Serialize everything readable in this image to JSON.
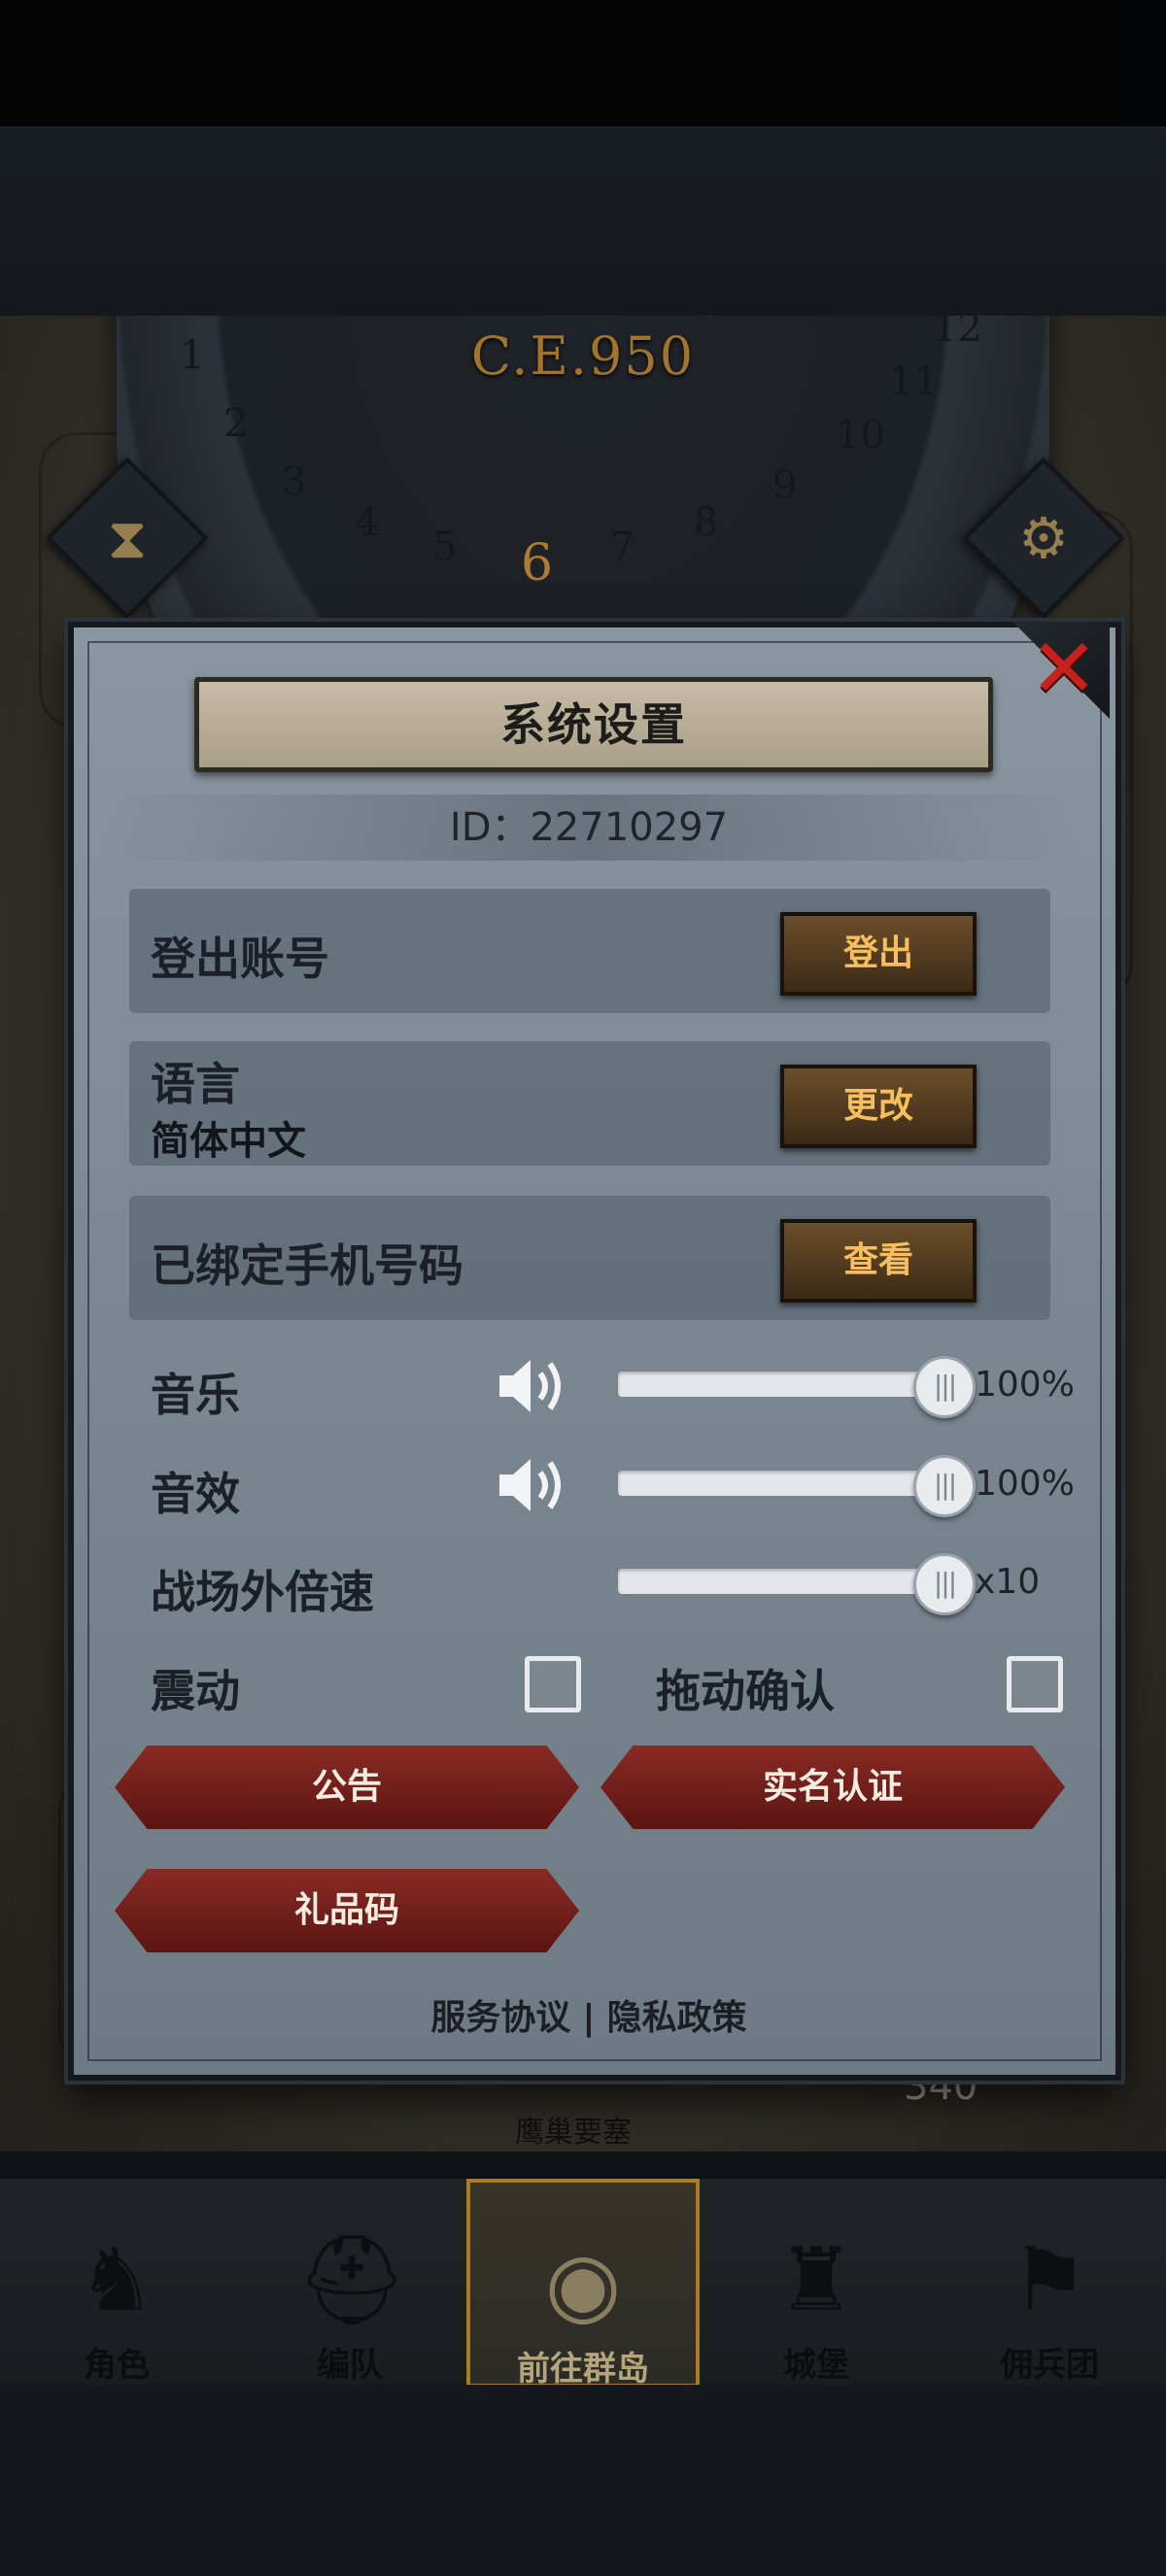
{
  "background": {
    "year": "C.E.950",
    "months": [
      "1",
      "2",
      "3",
      "4",
      "5",
      "6",
      "7",
      "8",
      "9",
      "10",
      "11",
      "12"
    ],
    "active_month": "6",
    "resource_count": "340",
    "place_label": "鹰巢要塞"
  },
  "dialog": {
    "title": "系统设置",
    "id_text": "ID：22710297",
    "rows": {
      "logout": {
        "label": "登出账号",
        "button": "登出"
      },
      "language": {
        "label": "语言",
        "value": "简体中文",
        "button": "更改"
      },
      "phone": {
        "label": "已绑定手机号码",
        "button": "查看"
      }
    },
    "sliders": {
      "music": {
        "label": "音乐",
        "value": "100%",
        "level": 1.0
      },
      "sfx": {
        "label": "音效",
        "value": "100%",
        "level": 1.0
      },
      "speed": {
        "label": "战场外倍速",
        "value": "x10",
        "level": 1.0
      }
    },
    "toggles": {
      "vibration": {
        "label": "震动",
        "checked": false
      },
      "drag_confirm": {
        "label": "拖动确认",
        "checked": false
      }
    },
    "buttons": {
      "notice": "公告",
      "realname": "实名认证",
      "giftcode": "礼品码"
    },
    "footer": {
      "service": "服务协议",
      "separator": "|",
      "privacy": "隐私政策"
    }
  },
  "navbar": {
    "items": [
      {
        "label": "角色",
        "icon": "knight-icon"
      },
      {
        "label": "编队",
        "icon": "helmet-icon"
      },
      {
        "label": "前往群岛",
        "icon": "globe-icon",
        "active": true
      },
      {
        "label": "城堡",
        "icon": "castle-icon"
      },
      {
        "label": "佣兵团",
        "icon": "banner-icon"
      }
    ]
  },
  "colors": {
    "accent_gold": "#e6a32c",
    "close_red": "#c8201c",
    "dialog_bg": "#7b8791",
    "red_button": "#8a2a24"
  }
}
